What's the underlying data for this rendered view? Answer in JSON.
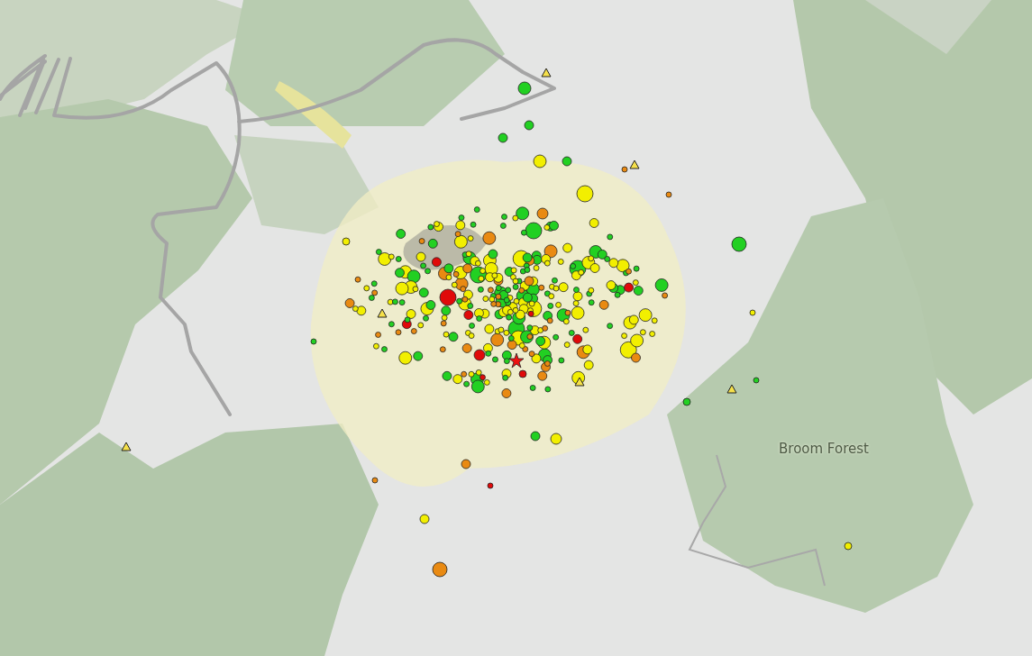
{
  "map": {
    "place_label": "Broom Forest"
  }
}
